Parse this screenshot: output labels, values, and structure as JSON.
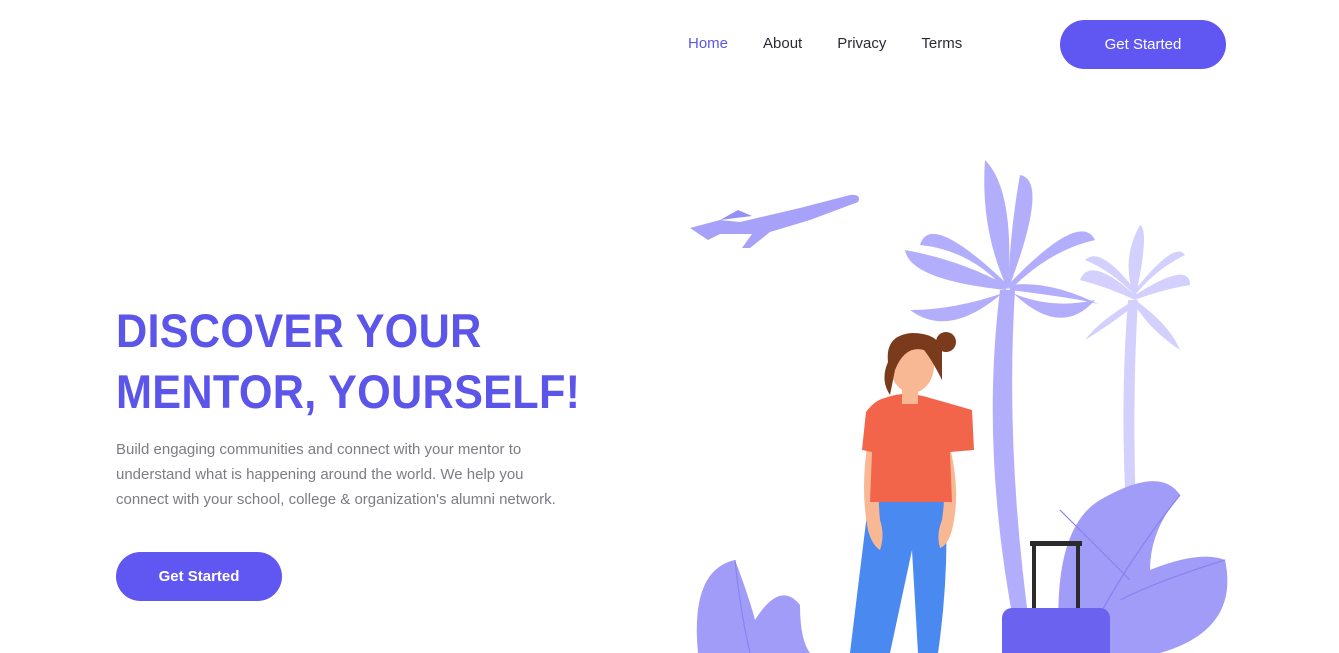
{
  "nav": {
    "links": [
      {
        "label": "Home",
        "active": true
      },
      {
        "label": "About",
        "active": false
      },
      {
        "label": "Privacy",
        "active": false
      },
      {
        "label": "Terms",
        "active": false
      }
    ],
    "cta_label": "Get Started"
  },
  "hero": {
    "title_line1": "DISCOVER YOUR",
    "title_line2": "MENTOR, YOURSELF!",
    "description_line1": "Build engaging communities and connect with your mentor to",
    "description_line2": "understand what is happening around the world. We help you",
    "description_line3": "connect with your school, college & organization's alumni network.",
    "cta_label": "Get Started"
  },
  "colors": {
    "accent": "#6057f3",
    "title": "#5b55ea",
    "palm_light": "#b3aefc",
    "palm_lighter": "#d3d0fd",
    "leaf": "#a19cf8",
    "shirt": "#f3654b",
    "jeans": "#4a8af0",
    "hair": "#7a3b1d",
    "skin": "#f9b894"
  },
  "illustration": {
    "icons": [
      "airplane-icon",
      "palm-tree-icon",
      "person-icon",
      "suitcase-icon",
      "leaf-icon"
    ]
  }
}
